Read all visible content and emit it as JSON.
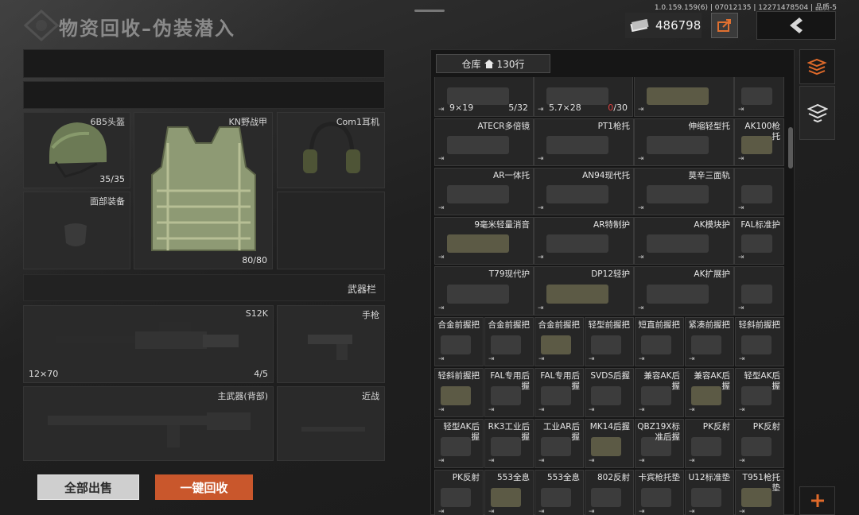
{
  "header": {
    "title": "物资回收–伪装潜入",
    "version": "1.0.159.159(6) | 07012135 | 12271478504 | 品质-5",
    "currency": "486798"
  },
  "equipment": {
    "helmet": {
      "label": "6B5头盔",
      "count": "35/35"
    },
    "armor": {
      "label": "KN野战甲",
      "count": "80/80"
    },
    "headset": {
      "label": "Com1耳机"
    },
    "face": {
      "label": "面部装备"
    },
    "weapon_bar": "武器栏",
    "primary": {
      "label": "S12K",
      "ammo": "12×70",
      "count": "4/5"
    },
    "pistol": {
      "label": "手枪"
    },
    "back": {
      "label": "主武器(背部)"
    },
    "melee": {
      "label": "近战"
    }
  },
  "buttons": {
    "sell_all": "全部出售",
    "recycle": "一键回收"
  },
  "inventory": {
    "tab": "仓库",
    "rows": "130行",
    "items": [
      {
        "name": "",
        "left": "9×19",
        "right": "5/32"
      },
      {
        "name": "",
        "left": "5.7×28",
        "right_red": "0",
        "right": "/30"
      },
      {
        "name": ""
      },
      {
        "name": ""
      },
      {
        "name": "ATECR多倍镜"
      },
      {
        "name": "PT1枪托"
      },
      {
        "name": "伸缩轻型托"
      },
      {
        "name": "AK100枪托"
      },
      {
        "name": "AR一体托"
      },
      {
        "name": "AN94现代托"
      },
      {
        "name": "莫辛三面轨"
      },
      {
        "name": ""
      },
      {
        "name": "9毫米轻量消音"
      },
      {
        "name": "AR特制护"
      },
      {
        "name": "AK模块护"
      },
      {
        "name": "FAL标准护"
      },
      {
        "name": "T79现代护"
      },
      {
        "name": "DP12轻护"
      },
      {
        "name": "AK扩展护"
      },
      {
        "name": ""
      },
      {
        "name": "合金前握把"
      },
      {
        "name": "合金前握把"
      },
      {
        "name": "合金前握把"
      },
      {
        "name": "轻型前握把"
      },
      {
        "name": "短直前握把"
      },
      {
        "name": "紧凑前握把"
      },
      {
        "name": "轻斜前握把"
      },
      {
        "name": "轻斜前握把"
      },
      {
        "name": "FAL专用后握"
      },
      {
        "name": "FAL专用后握"
      },
      {
        "name": "SVDS后握"
      },
      {
        "name": "兼容AK后握"
      },
      {
        "name": "兼容AK后握"
      },
      {
        "name": "轻型AK后握"
      },
      {
        "name": "轻型AK后握"
      },
      {
        "name": "RK3工业后握"
      },
      {
        "name": "工业AR后握"
      },
      {
        "name": "MK14后握"
      },
      {
        "name": "QBZ19X标准后握"
      },
      {
        "name": "PK反射"
      },
      {
        "name": "PK反射"
      },
      {
        "name": "PK反射"
      },
      {
        "name": "553全息"
      },
      {
        "name": "553全息"
      },
      {
        "name": "802反射"
      },
      {
        "name": "卡宾枪托垫"
      },
      {
        "name": "U12标准垫"
      },
      {
        "name": "T951枪托垫"
      }
    ]
  },
  "colors": {
    "accent": "#c9572c",
    "red_text": "#e04040"
  }
}
